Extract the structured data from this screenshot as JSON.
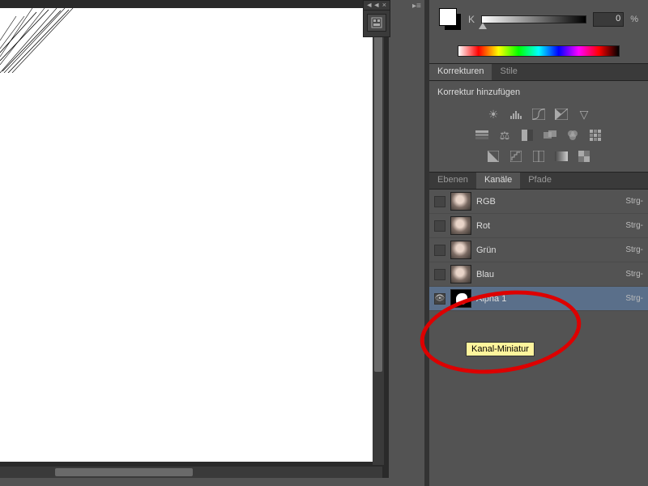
{
  "color": {
    "k_label": "K",
    "value": "0",
    "pct": "%"
  },
  "tabs1": {
    "korrekturen": "Korrekturen",
    "stile": "Stile"
  },
  "adjustments": {
    "title": "Korrektur hinzufügen"
  },
  "tabs2": {
    "ebenen": "Ebenen",
    "kanale": "Kanäle",
    "pfade": "Pfade"
  },
  "channels": [
    {
      "name": "RGB",
      "shortcut": "Strg-"
    },
    {
      "name": "Rot",
      "shortcut": "Strg-"
    },
    {
      "name": "Grün",
      "shortcut": "Strg-"
    },
    {
      "name": "Blau",
      "shortcut": "Strg-"
    },
    {
      "name": "Alpha 1",
      "shortcut": "Strg-"
    }
  ],
  "tooltip": "Kanal-Miniatur"
}
